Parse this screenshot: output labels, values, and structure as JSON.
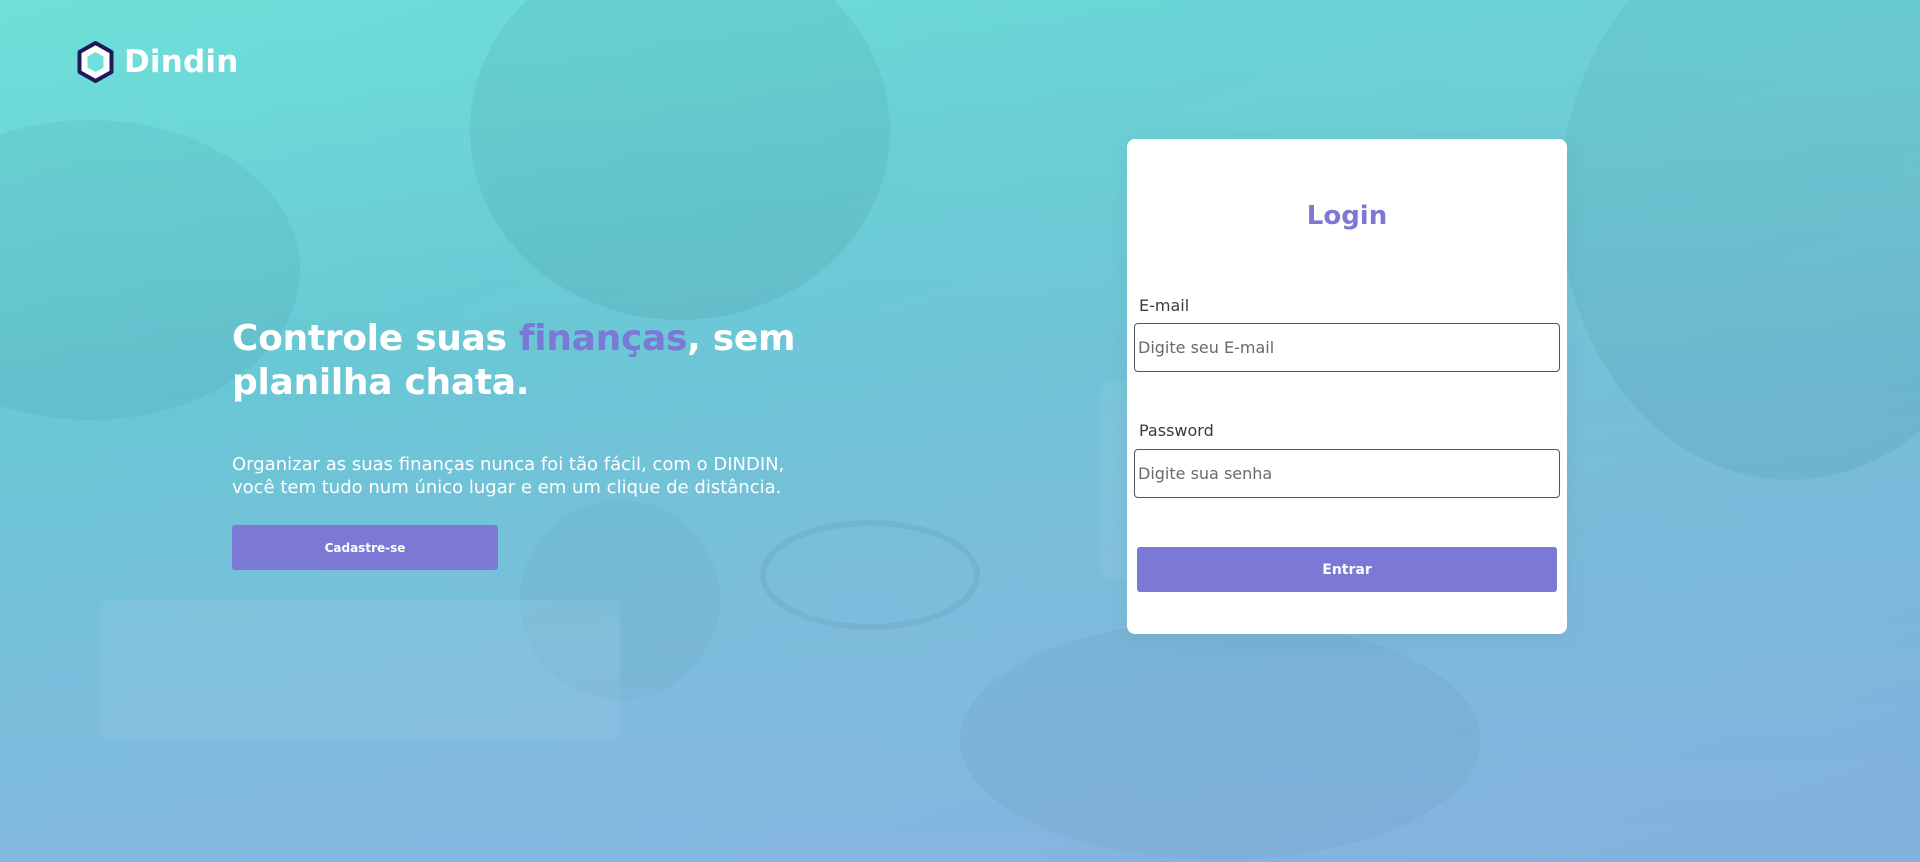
{
  "brand": {
    "name": "Dindin",
    "logo_icon": "hexagon-icon",
    "accent_color": "#7b78d6"
  },
  "hero": {
    "headline_part1": "Controle suas ",
    "headline_accent": "finanças",
    "headline_part2": ", sem planilha chata.",
    "subtext": "Organizar as suas finanças nunca foi tão fácil, com o DINDIN, você tem tudo num único lugar e em um clique de distância.",
    "signup_label": "Cadastre-se"
  },
  "login": {
    "title": "Login",
    "email_label": "E-mail",
    "email_placeholder": "Digite seu E-mail",
    "password_label": "Password",
    "password_placeholder": "Digite sua senha",
    "submit_label": "Entrar"
  }
}
